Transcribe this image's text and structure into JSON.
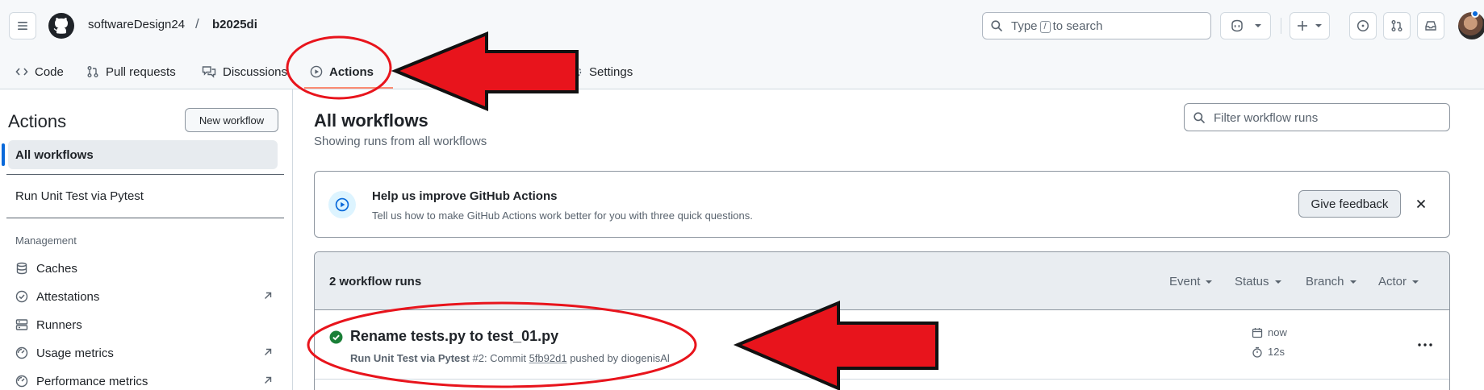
{
  "header": {
    "owner": "softwareDesign24",
    "separator": "/",
    "repo": "b2025di",
    "search_pre": "Type",
    "search_key": "/",
    "search_post": "to search"
  },
  "tabs": [
    {
      "label": "Code",
      "icon": "code-icon"
    },
    {
      "label": "Pull requests",
      "icon": "git-pull-request-icon"
    },
    {
      "label": "Discussions",
      "icon": "comment-discussion-icon"
    },
    {
      "label": "Actions",
      "icon": "play-icon",
      "active": true
    },
    {
      "label": "Settings",
      "icon": "gear-icon"
    }
  ],
  "sidebar": {
    "title": "Actions",
    "new_workflow": "New workflow",
    "all_workflows": "All workflows",
    "workflow": "Run Unit Test via Pytest",
    "section": "Management",
    "items": [
      {
        "label": "Caches",
        "icon": "database-icon"
      },
      {
        "label": "Attestations",
        "icon": "check-circle-icon",
        "external": true
      },
      {
        "label": "Runners",
        "icon": "server-icon"
      },
      {
        "label": "Usage metrics",
        "icon": "meter-icon",
        "external": true
      },
      {
        "label": "Performance metrics",
        "icon": "meter-icon",
        "external": true
      }
    ]
  },
  "main": {
    "title": "All workflows",
    "subtitle": "Showing runs from all workflows",
    "filter_placeholder": "Filter workflow runs",
    "banner": {
      "title": "Help us improve GitHub Actions",
      "text": "Tell us how to make GitHub Actions work better for you with three quick questions.",
      "button": "Give feedback"
    },
    "runs": {
      "count": "2 workflow runs",
      "filters": [
        "Event",
        "Status",
        "Branch",
        "Actor"
      ],
      "items": [
        {
          "title": "Rename tests.py to test_01.py",
          "workflow": "Run Unit Test via Pytest",
          "number": "#2",
          "commit_label": ": Commit",
          "sha": "5fb92d1",
          "pushed_by": "pushed by diogenisAl",
          "when": "now",
          "duration": "12s",
          "status": "success"
        }
      ]
    }
  },
  "colors": {
    "accent": "#0969da",
    "success": "#1a7f37",
    "annotation_red": "#e8141c",
    "tab_underline": "#fd8c73"
  }
}
